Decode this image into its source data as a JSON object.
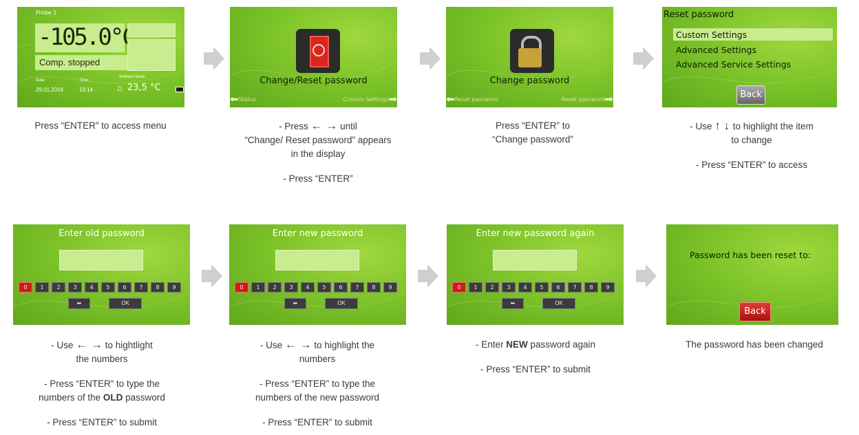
{
  "screens": {
    "s1": {
      "probe": "Probe 1",
      "temperature": "-105.0°C",
      "status": "Comp. stopped",
      "date_label": "Date:",
      "date": "29.01.2016",
      "time_label": "Time:",
      "time": "13:14",
      "ambient_label": "Ambient temp.:",
      "ambient": "23,5 °C"
    },
    "s2": {
      "title": "Change/Reset password",
      "left_nav": "Status",
      "right_nav": "Custom Settings"
    },
    "s3": {
      "title": "Change password",
      "left_nav": "Reset password",
      "right_nav": "Reset password"
    },
    "s4": {
      "title": "Reset password",
      "items": [
        "Custom Settings",
        "Advanced Settings",
        "Advanced Service Settings"
      ],
      "back": "Back"
    },
    "s5": {
      "title": "Enter old password"
    },
    "s6": {
      "title": "Enter new password"
    },
    "s7": {
      "title": "Enter new password again"
    },
    "s8": {
      "message": "Password has been reset to:",
      "back": "Back"
    },
    "keypad": {
      "keys": [
        "0",
        "1",
        "2",
        "3",
        "4",
        "5",
        "6",
        "7",
        "8",
        "9"
      ],
      "ok": "OK",
      "back_icon": "left-arrow-icon"
    }
  },
  "captions": {
    "c1": [
      "Press “ENTER” to access menu"
    ],
    "c2": {
      "l1a": "- Press ",
      "l1b": " until",
      "l2": "“Change/ Reset password” appears",
      "l3": "in the display",
      "l4": "- Press “ENTER”"
    },
    "c3": {
      "l1": "Press “ENTER” to",
      "l2": "“Change password”"
    },
    "c4": {
      "l1a": "- Use ",
      "l1b": " to highlight the item",
      "l2": "to change",
      "l3": "- Press “ENTER” to access"
    },
    "c5": {
      "l1a": "- Use ",
      "l1b": " to hightlight",
      "l2": "the numbers",
      "l3": "- Press “ENTER” to type the",
      "l4a": "numbers  of the ",
      "l4b": "OLD",
      "l4c": " password",
      "l5": "- Press “ENTER” to submit"
    },
    "c6": {
      "l1a": "- Use ",
      "l1b": " to highlight the",
      "l2": "numbers",
      "l3": "- Press “ENTER” to type the",
      "l4": "numbers of the new password",
      "l5": "- Press “ENTER” to submit"
    },
    "c7": {
      "l1a": "- Enter ",
      "l1b": "NEW",
      "l1c": " password again",
      "l2": "- Press “ENTER” to submit"
    },
    "c8": {
      "l1": "The password has been changed"
    }
  },
  "colors": {
    "screen_green": "#7ec42a",
    "arrow_gray": "#cfcfcf",
    "key_selected": "#cc1b1b",
    "back_red": "#c8201e"
  }
}
